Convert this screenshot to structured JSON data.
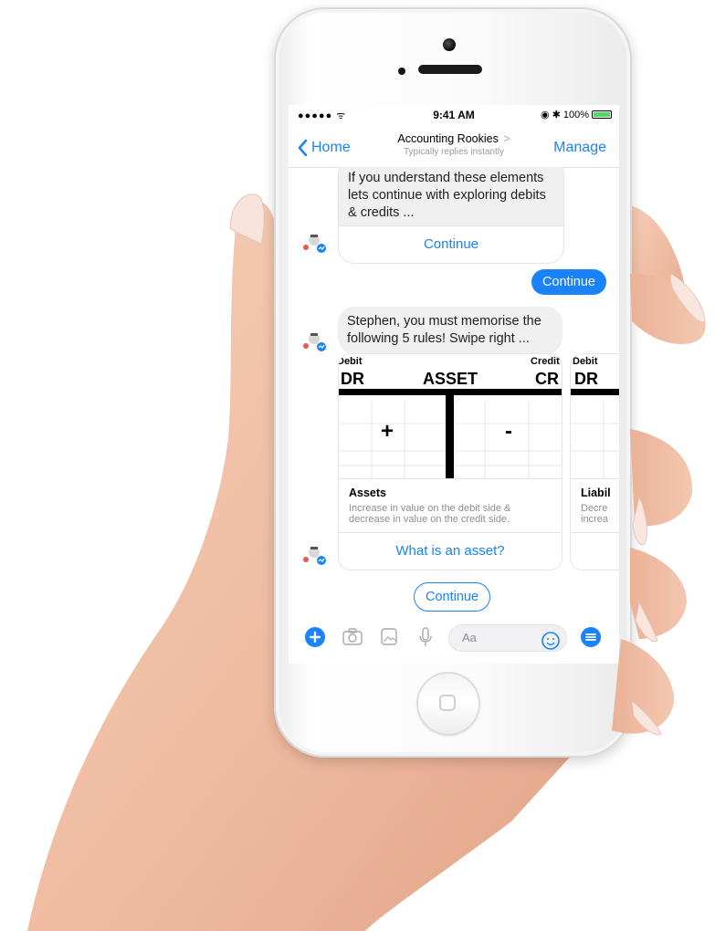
{
  "status_bar": {
    "carrier": "●●●●● ᯤ",
    "time": "9:41 AM",
    "battery": "100%"
  },
  "nav": {
    "back_label": "Home",
    "title": "Accounting Rookies",
    "subtitle": "Typically replies instantly",
    "manage_label": "Manage"
  },
  "messages": {
    "card1_text": "If you understand these elements lets continue with exploring debits & credits ...",
    "card1_button": "Continue",
    "user_reply": "Continue",
    "bot_text": "Stephen, you must memorise the following 5 rules! Swipe right ..."
  },
  "carousel": [
    {
      "title": "Assets",
      "subtitle": "Increase in value on the debit side & decrease in value on the credit side.",
      "button": "What is an asset?",
      "image": {
        "debit": "Debit",
        "credit": "Credit",
        "dr": "DR",
        "cr": "CR",
        "heading": "ASSET",
        "plus": "+",
        "minus": "-"
      }
    },
    {
      "title": "Liabil",
      "subtitle": "Decre\nincrea",
      "image": {
        "debit": "Debit",
        "dr": "DR"
      }
    }
  ],
  "quick_reply": "Continue",
  "composer": {
    "placeholder": "Aa"
  },
  "colors": {
    "accent": "#1a82fb",
    "bubble_grey": "#f1f0f0",
    "skin": "#f2c2a8"
  }
}
